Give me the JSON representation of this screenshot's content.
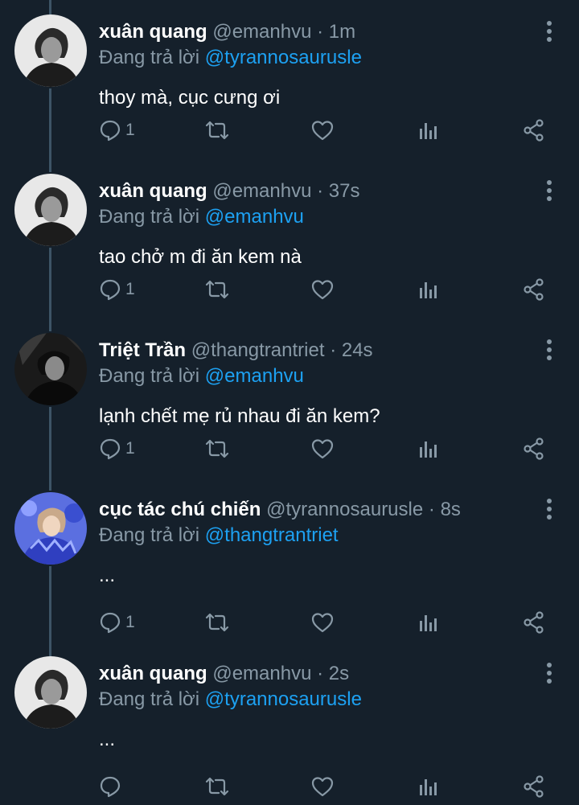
{
  "tweets": [
    {
      "name": "xuân quang",
      "handle": "@emanhvu",
      "separator": "·",
      "time": "1m",
      "reply_label": "Đang trả lời",
      "reply_to": "@tyrannosaurusle",
      "text": "thoy mà, cục cưng ơi",
      "reply_count": "1",
      "avatar": "avatar-xuan-quang"
    },
    {
      "name": "xuân quang",
      "handle": "@emanhvu",
      "separator": "·",
      "time": "37s",
      "reply_label": "Đang trả lời",
      "reply_to": "@emanhvu",
      "text": "tao chở m đi ăn kem nà",
      "reply_count": "1",
      "avatar": "avatar-xuan-quang"
    },
    {
      "name": "Triệt Trần",
      "handle": "@thangtrantriet",
      "separator": "·",
      "time": "24s",
      "reply_label": "Đang trả lời",
      "reply_to": "@emanhvu",
      "text": "lạnh chết mẹ rủ nhau đi ăn kem?",
      "reply_count": "1",
      "avatar": "avatar-triet-tran"
    },
    {
      "name": "cục tác chú chiến",
      "handle": "@tyrannosaurusle",
      "separator": "·",
      "time": "8s",
      "reply_label": "Đang trả lời",
      "reply_to": "@thangtrantriet",
      "text": "...",
      "reply_count": "1",
      "avatar": "avatar-cuc-tac"
    },
    {
      "name": "xuân quang",
      "handle": "@emanhvu",
      "separator": "·",
      "time": "2s",
      "reply_label": "Đang trả lời",
      "reply_to": "@tyrannosaurusle",
      "text": "...",
      "reply_count": "",
      "avatar": "avatar-xuan-quang"
    }
  ],
  "icons": {
    "reply": "reply-icon",
    "retweet": "retweet-icon",
    "like": "heart-icon",
    "analytics": "analytics-icon",
    "share": "share-icon",
    "more": "more-vertical-icon"
  },
  "colors": {
    "background": "#15202b",
    "secondary_text": "#8899a6",
    "mention": "#1da1f2",
    "thread_line": "#3d5466"
  }
}
